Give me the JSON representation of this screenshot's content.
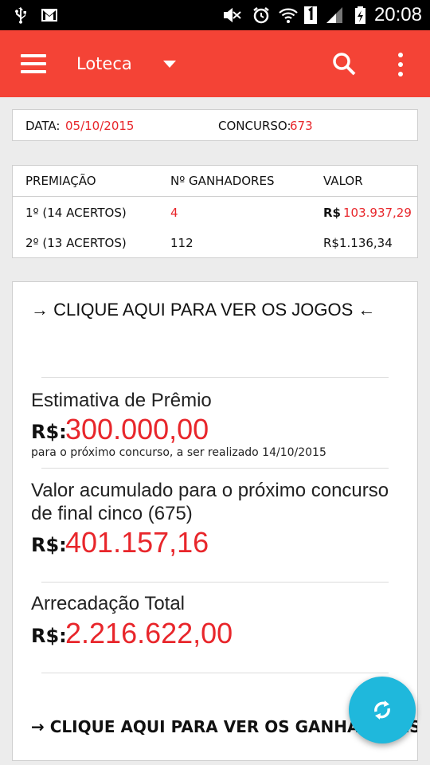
{
  "status_bar": {
    "time": "20:08"
  },
  "app_bar": {
    "title": "Loteca"
  },
  "draw_info": {
    "date_label": "DATA:",
    "date_value": "05/10/2015",
    "contest_label": "CONCURSO:",
    "contest_value": "673"
  },
  "prize_table": {
    "headers": [
      "PREMIAÇÃO",
      "Nº GANHADORES",
      "VALOR"
    ],
    "rows": [
      {
        "tier": "1º (14 ACERTOS)",
        "winners": "4",
        "currency": "R$",
        "amount": "103.937,29"
      },
      {
        "tier": "2º (13 ACERTOS)",
        "winners": "112",
        "currency": "",
        "amount": "R$1.136,34"
      }
    ]
  },
  "main": {
    "games_link": "→ CLIQUE AQUI PARA VER OS JOGOS ←",
    "estimate": {
      "label": "Estimativa de Prêmio",
      "currency": "R$:",
      "value": "300.000,00",
      "note": "para o próximo concurso, a ser realizado 14/10/2015"
    },
    "accumulated": {
      "label_line1": "Valor acumulado para o próximo concurso",
      "label_line2": "de final  cinco (675)",
      "currency": "R$:",
      "value": "401.157,16"
    },
    "total": {
      "label": "Arrecadação Total",
      "currency": "R$:",
      "value": "2.216.622,00"
    },
    "winners_link": "→ CLIQUE AQUI PARA VER OS GANHADORES ←"
  },
  "colors": {
    "app_bar": "#f44336",
    "accent_red": "#e8262b",
    "fab": "#1fb8dc"
  },
  "icons": [
    "usb-icon",
    "gmail-icon",
    "mute-icon",
    "alarm-icon",
    "wifi-icon",
    "sim-icon",
    "signal-icon",
    "battery-icon",
    "menu-icon",
    "dropdown-icon",
    "search-icon",
    "overflow-icon",
    "refresh-icon"
  ]
}
